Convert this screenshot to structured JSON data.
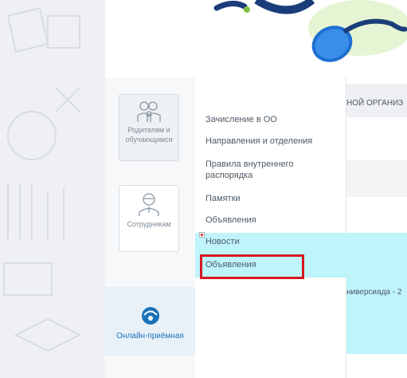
{
  "sidebar": {
    "parents_label": "Родителям и обучающимся",
    "staff_label": "Сотрудникам",
    "online_label": "Онлайн-приёмная"
  },
  "menu": {
    "items": [
      "Зачисление в ОО",
      "Направления и отделения",
      "Правила внутреннего распорядка",
      "Памятки",
      "Объявления",
      "Новости",
      "Объявления"
    ]
  },
  "content": {
    "header_fragment": "НОЙ ОРГАНИЗ",
    "news_fragment": "ниверсиада - 2"
  },
  "colors": {
    "highlight": "#bff4fb",
    "annotation_box": "#d71920",
    "link_blue": "#1a73b8"
  },
  "icons": [
    "parents-icon",
    "staff-icon",
    "headset-icon",
    "mouse-icon",
    "broken-image-icon"
  ]
}
